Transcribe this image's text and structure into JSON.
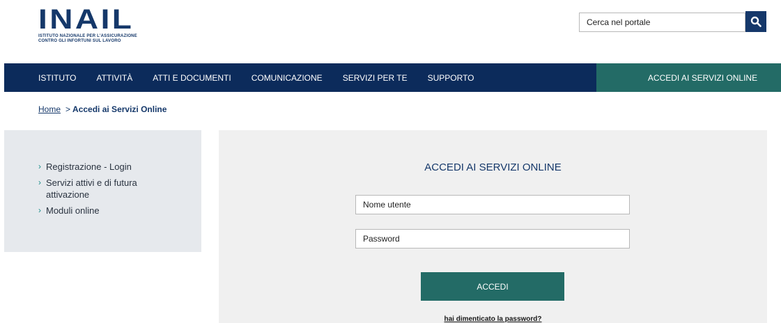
{
  "brand": {
    "logo_text": "INAIL",
    "logo_subtitle": "ISTITUTO NAZIONALE PER L'ASSICURAZIONE\nCONTRO GLI INFORTUNI SUL LAVORO",
    "primary_color": "#0c2b5b",
    "accent_color": "#236b66"
  },
  "search": {
    "placeholder": "Cerca nel portale",
    "icon": "search-icon"
  },
  "nav": {
    "items": [
      {
        "label": "ISTITUTO"
      },
      {
        "label": "ATTIVITÀ"
      },
      {
        "label": "ATTI E DOCUMENTI"
      },
      {
        "label": "COMUNICAZIONE"
      },
      {
        "label": "SERVIZI PER TE"
      },
      {
        "label": "SUPPORTO"
      }
    ],
    "access_label": "ACCEDI AI SERVIZI ONLINE"
  },
  "breadcrumb": {
    "home": "Home",
    "separator": ">",
    "current": "Accedi ai Servizi Online"
  },
  "sidebar": {
    "chevron": "›",
    "items": [
      {
        "label": "Registrazione - Login"
      },
      {
        "label": "Servizi attivi e di futura attivazione"
      },
      {
        "label": "Moduli online"
      }
    ]
  },
  "login": {
    "title": "ACCEDI AI SERVIZI ONLINE",
    "username_placeholder": "Nome utente",
    "password_placeholder": "Password",
    "submit_label": "ACCEDI",
    "forgot_label": "hai dimenticato la password?"
  }
}
